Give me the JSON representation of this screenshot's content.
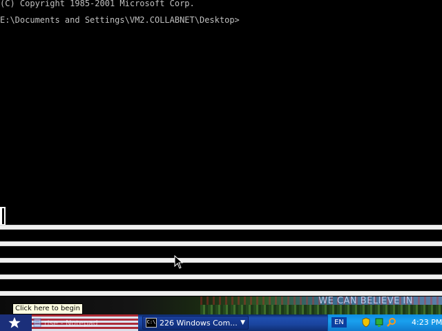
{
  "console": {
    "line1": "(C) Copyright 1985-2001 Microsoft Corp.",
    "line2": "E:\\Documents and Settings\\VM2.COLLABNET\\Desktop>"
  },
  "wallpaper": {
    "slogan": "WE CAN BELIEVE IN"
  },
  "tooltip": {
    "text": "Click here to begin"
  },
  "taskbar": {
    "start_icon": "star-icon",
    "tasks": [
      {
        "label": "rise - Notepad",
        "icon": "notepad-icon"
      },
      {
        "label": "226 Windows Com...",
        "icon": "command-prompt-icon",
        "count": "226"
      }
    ],
    "language": "EN",
    "tray_icons": [
      "shield-icon",
      "network-icon",
      "search-icon"
    ],
    "clock": "4:23 PM"
  },
  "colors": {
    "console_bg": "#000000",
    "console_text": "#c0c0c0",
    "taskbar_blue": "#1f4fb0",
    "tray_blue": "#1aa0ee",
    "tooltip_bg": "#ffffe1"
  }
}
